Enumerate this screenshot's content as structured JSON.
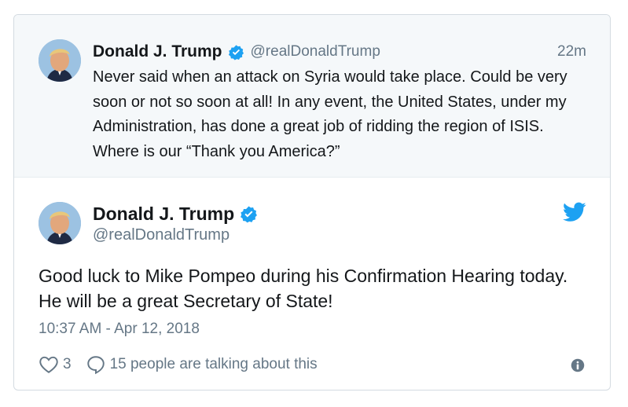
{
  "colors": {
    "twitter_blue": "#1da1f2",
    "text": "#14171a",
    "secondary": "#657786",
    "parent_bg": "#f5f8fa",
    "border": "#d4dbe1"
  },
  "parent_tweet": {
    "author_name": "Donald J. Trump",
    "verified_icon": "verified-badge-icon",
    "handle": "@realDonaldTrump",
    "time": "22m",
    "text": "Never said when an attack on Syria would take place. Could be very soon or not so soon at all! In any event, the United States, under my Administration, has done a great job of ridding the region of ISIS. Where is our “Thank you America?”"
  },
  "main_tweet": {
    "author_name": "Donald J. Trump",
    "verified_icon": "verified-badge-icon",
    "handle": "@realDonaldTrump",
    "logo_icon": "twitter-bird-icon",
    "text": "Good luck to Mike Pompeo during his Confirmation Hearing today. He will be a great Secretary of State!",
    "timestamp": "10:37 AM - Apr 12, 2018",
    "likes_count": "3",
    "reply_label": "15 people are talking about this",
    "info_icon": "info-icon"
  }
}
